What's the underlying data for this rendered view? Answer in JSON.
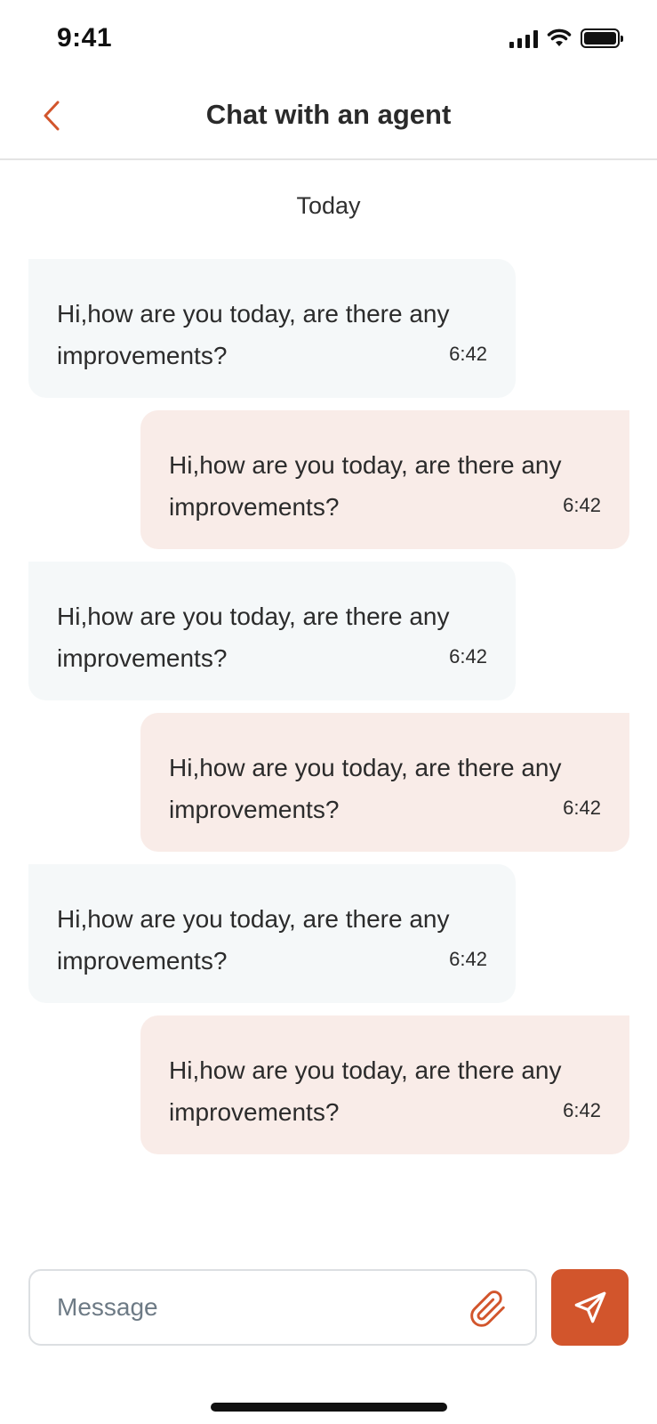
{
  "status_bar": {
    "time": "9:41",
    "icons": [
      "signal-icon",
      "wifi-icon",
      "battery-icon"
    ]
  },
  "header": {
    "back_icon": "chevron-left-icon",
    "title": "Chat with an agent"
  },
  "date_divider": "Today",
  "messages": [
    {
      "sender": "agent",
      "text": "Hi,how are you today, are there any improvements?",
      "time": "6:42"
    },
    {
      "sender": "user",
      "text": "Hi,how are you today, are there any improvements?",
      "time": "6:42"
    },
    {
      "sender": "agent",
      "text": "Hi,how are you today, are there any improvements?",
      "time": "6:42"
    },
    {
      "sender": "user",
      "text": "Hi,how are you today, are there any improvements?",
      "time": "6:42"
    },
    {
      "sender": "agent",
      "text": "Hi,how are you today, are there any improvements?",
      "time": "6:42"
    },
    {
      "sender": "user",
      "text": "Hi,how are you today, are there any improvements?",
      "time": "6:42"
    }
  ],
  "composer": {
    "placeholder": "Message",
    "value": "",
    "attach_icon": "paperclip-icon",
    "send_icon": "send-icon"
  },
  "colors": {
    "accent": "#d2552c",
    "agent_bubble": "#f5f8f9",
    "user_bubble": "#f9ece8",
    "text": "#2b2b2b"
  }
}
